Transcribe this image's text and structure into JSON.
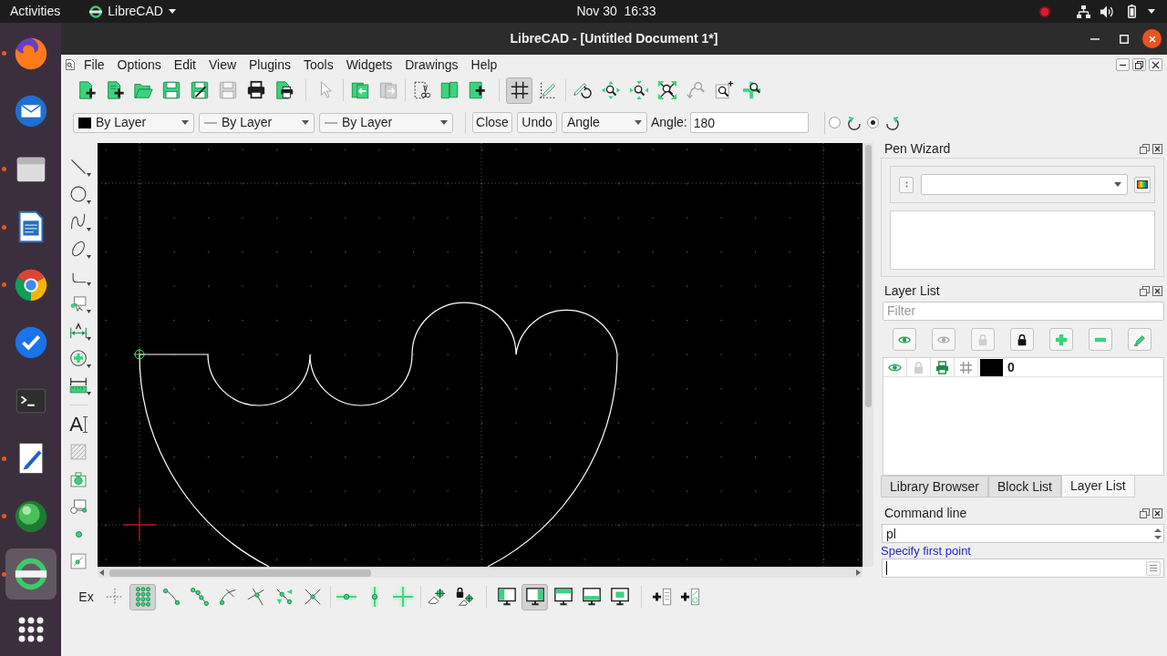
{
  "top_bar": {
    "activities": "Activities",
    "app_menu": "LibreCAD",
    "clock": "Nov 30  16:33"
  },
  "dock": [
    {
      "kind": "globe",
      "running": true,
      "selected": false
    },
    {
      "kind": "mail",
      "running": false,
      "selected": false
    },
    {
      "kind": "folder",
      "running": true,
      "selected": false
    },
    {
      "kind": "document",
      "running": true,
      "selected": false
    },
    {
      "kind": "wheel",
      "running": true,
      "selected": false
    },
    {
      "kind": "check",
      "running": false,
      "selected": false
    },
    {
      "kind": "terminal",
      "running": false,
      "selected": false
    },
    {
      "kind": "editor",
      "running": true,
      "selected": false
    },
    {
      "kind": "sphere",
      "running": true,
      "selected": false
    },
    {
      "kind": "ring",
      "running": true,
      "selected": true
    }
  ],
  "window": {
    "title": "LibreCAD - [Untitled Document 1*]"
  },
  "menu": [
    "File",
    "Options",
    "Edit",
    "View",
    "Plugins",
    "Tools",
    "Widgets",
    "Drawings",
    "Help"
  ],
  "main_toolbar": [
    [
      {
        "kind": "new",
        "disabled": false
      },
      {
        "kind": "template",
        "disabled": false
      },
      {
        "kind": "open",
        "disabled": false
      },
      {
        "kind": "save",
        "disabled": false
      },
      {
        "kind": "save_as",
        "disabled": false
      },
      {
        "kind": "save_all",
        "disabled": true
      },
      {
        "kind": "print",
        "disabled": false
      },
      {
        "kind": "print_preview",
        "disabled": false
      }
    ],
    [
      {
        "kind": "select",
        "disabled": true
      }
    ],
    [
      {
        "kind": "undo",
        "disabled": false
      },
      {
        "kind": "redo",
        "disabled": true
      }
    ],
    [
      {
        "kind": "cut",
        "disabled": false
      },
      {
        "kind": "copy",
        "disabled": false
      },
      {
        "kind": "paste",
        "disabled": false
      }
    ],
    [
      {
        "kind": "grid",
        "pressed": true
      },
      {
        "kind": "draft",
        "pressed": false
      }
    ],
    [
      {
        "kind": "redraw",
        "disabled": false
      },
      {
        "kind": "zoom_in",
        "disabled": false
      },
      {
        "kind": "zoom_out",
        "disabled": false
      },
      {
        "kind": "auto_zoom",
        "disabled": false
      },
      {
        "kind": "previous_view",
        "disabled": true
      },
      {
        "kind": "window_zoom",
        "disabled": false
      },
      {
        "kind": "pan_zoom",
        "disabled": false
      }
    ]
  ],
  "pen_toolbar": [
    {
      "kind": "color",
      "label": "By Layer"
    },
    {
      "kind": "width",
      "label": "By Layer"
    },
    {
      "kind": "type",
      "label": "By Layer"
    }
  ],
  "tool_options": {
    "buttons": [
      "Close",
      "Undo"
    ],
    "mode": "Angle",
    "angle_label": "Angle:",
    "angle": "180",
    "directions": [
      {
        "kind": "counterclockwise",
        "selected": false
      },
      {
        "kind": "clockwise",
        "selected": true
      }
    ]
  },
  "left_toolbar": [
    [
      {
        "kind": "line",
        "submenu": true
      },
      {
        "kind": "circle",
        "submenu": true
      },
      {
        "kind": "spline",
        "submenu": true
      },
      {
        "kind": "ellipse",
        "submenu": true
      },
      {
        "kind": "polyline",
        "submenu": true
      },
      {
        "kind": "select",
        "submenu": true
      },
      {
        "kind": "dimension",
        "submenu": true
      },
      {
        "kind": "modify",
        "submenu": true
      },
      {
        "kind": "measure",
        "submenu": true
      }
    ],
    [
      {
        "kind": "text",
        "glyph": "A",
        "submenu": false
      },
      {
        "kind": "hatch",
        "submenu": false
      },
      {
        "kind": "image",
        "submenu": false
      },
      {
        "kind": "block",
        "submenu": false
      },
      {
        "kind": "point",
        "submenu": false
      },
      {
        "kind": "insert",
        "submenu": false
      }
    ]
  ],
  "pen_wizard": {
    "title": "Pen Wizard"
  },
  "layer_list": {
    "title": "Layer List",
    "filter": {
      "placeholder": "Filter"
    },
    "layers": [
      {
        "name": "0",
        "visible": true,
        "locked": false,
        "printable": true,
        "construction": false,
        "color": "#000000"
      }
    ]
  },
  "dock_tabs": [
    {
      "label": "Library Browser",
      "selected": false
    },
    {
      "label": "Block List",
      "selected": false
    },
    {
      "label": "Layer List",
      "selected": true
    }
  ],
  "command_line": {
    "title": "Command line",
    "history": [
      "pl"
    ],
    "prompt": "Specify first point"
  },
  "snap_toolbar": [
    [
      {
        "kind": "exclusive",
        "label": "Ex",
        "pressed": false
      },
      {
        "kind": "free",
        "pressed": false
      },
      {
        "kind": "grid",
        "pressed": true
      },
      {
        "kind": "endpoints",
        "pressed": false
      },
      {
        "kind": "on_entity",
        "pressed": false
      },
      {
        "kind": "center",
        "pressed": false
      },
      {
        "kind": "middle",
        "pressed": false
      },
      {
        "kind": "distance",
        "pressed": false
      },
      {
        "kind": "intersection",
        "pressed": false
      }
    ],
    [
      {
        "kind": "restrict_horizontal",
        "pressed": false
      },
      {
        "kind": "restrict_vertical",
        "pressed": false
      },
      {
        "kind": "restrict_orthogonal",
        "pressed": false
      }
    ],
    [
      {
        "kind": "set_relative_zero",
        "pressed": false
      },
      {
        "kind": "lock_relative_zero",
        "pressed": false
      }
    ],
    [
      {
        "kind": "view_left",
        "pressed": false
      },
      {
        "kind": "view_right",
        "pressed": true
      },
      {
        "kind": "view_top",
        "pressed": false
      },
      {
        "kind": "view_bottom",
        "pressed": false
      },
      {
        "kind": "view_floating",
        "pressed": false
      }
    ],
    [
      {
        "kind": "add_list",
        "pressed": false
      },
      {
        "kind": "add_panel",
        "pressed": false
      }
    ]
  ]
}
